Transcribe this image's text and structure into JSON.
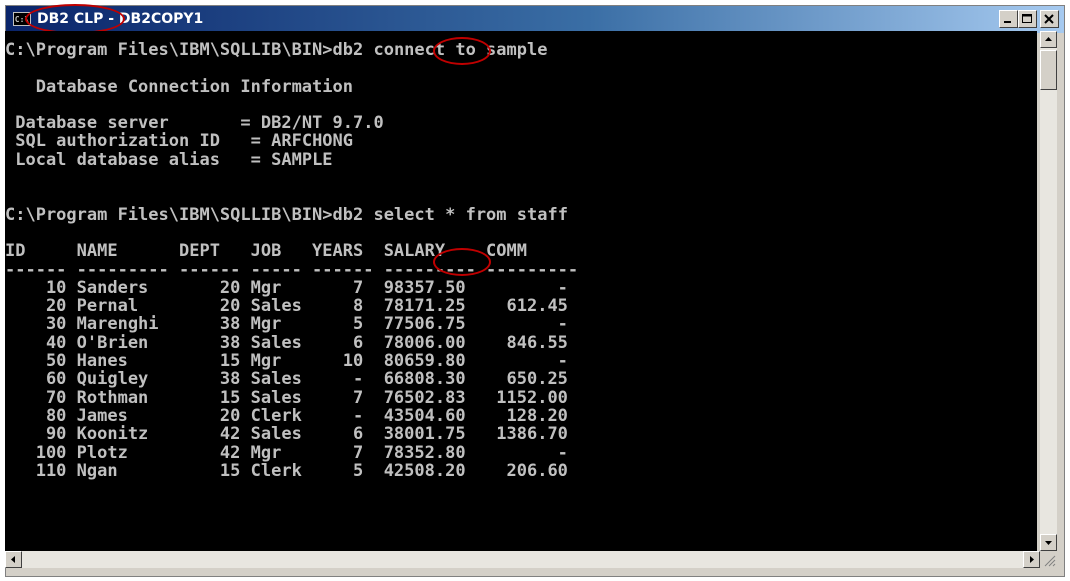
{
  "window": {
    "title_app": "DB2 CLP",
    "title_rest": " - DB2COPY1",
    "icon_label": "C:\\"
  },
  "console": {
    "prompt1": "C:\\Program Files\\IBM\\SQLLIB\\BIN>",
    "command1_name": "db2",
    "command1_args": " connect to sample",
    "conn_header": "   Database Connection Information",
    "conn_server_label": " Database server",
    "conn_server_value": "= DB2/NT 9.7.0",
    "conn_auth_label": " SQL authorization ID",
    "conn_auth_value": "= ARFCHONG",
    "conn_alias_label": " Local database alias",
    "conn_alias_value": "= SAMPLE",
    "prompt2": "C:\\Program Files\\IBM\\SQLLIB\\BIN>",
    "command2_name": "db2",
    "command2_args": " select * from staff",
    "table_header": "ID     NAME      DEPT   JOB   YEARS  SALARY    COMM",
    "table_rule": "------ --------- ------ ----- ------ --------- ---------",
    "rows": [
      "    10 Sanders       20 Mgr       7  98357.50         -",
      "    20 Pernal        20 Sales     8  78171.25    612.45",
      "    30 Marenghi      38 Mgr       5  77506.75         -",
      "    40 O'Brien       38 Sales     6  78006.00    846.55",
      "    50 Hanes         15 Mgr      10  80659.80         -",
      "    60 Quigley       38 Sales     -  66808.30    650.25",
      "    70 Rothman       15 Sales     7  76502.83   1152.00",
      "    80 James         20 Clerk     -  43504.60    128.20",
      "    90 Koonitz       42 Sales     6  38001.75   1386.70",
      "   100 Plotz         42 Mgr       7  78352.80         -",
      "   110 Ngan          15 Clerk     5  42508.20    206.60"
    ]
  },
  "icons": {
    "minimize": "minimize-icon",
    "maximize": "maximize-icon",
    "close": "close-icon",
    "scroll_up": "arrow-up-icon",
    "scroll_down": "arrow-down-icon",
    "scroll_left": "arrow-left-icon",
    "scroll_right": "arrow-right-icon"
  },
  "colors": {
    "console_bg": "#000000",
    "console_text": "#c0c0c0",
    "annotation": "#c00000",
    "titlebar_start": "#0a246a",
    "titlebar_end": "#a6caf0"
  }
}
